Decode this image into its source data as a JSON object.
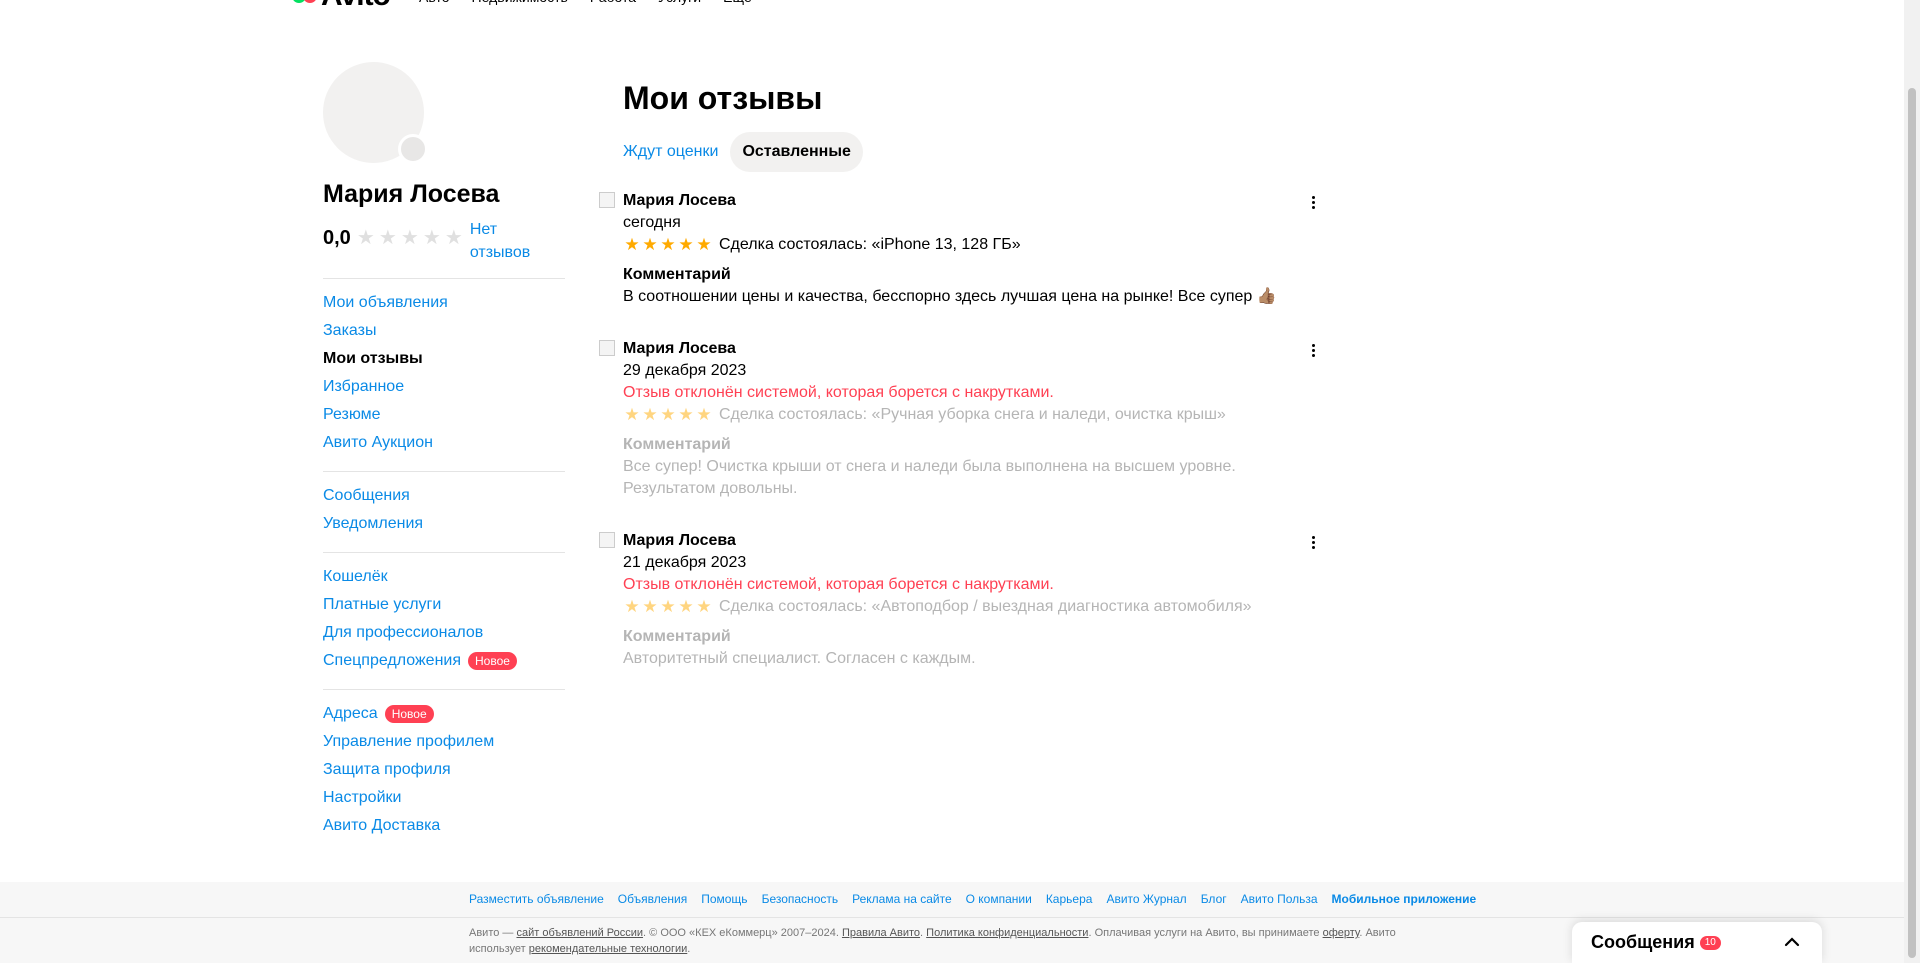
{
  "header": {
    "logo_text": "Avito",
    "nav": [
      "Авто",
      "Недвижимость",
      "Работа",
      "Услуги",
      "Ещё"
    ]
  },
  "profile": {
    "name": "Мария Лосева",
    "rating": "0,0",
    "no_reviews": "Нет отзывов",
    "star_count": 5,
    "filled_stars": 0
  },
  "sidebar": {
    "groups": [
      [
        {
          "label": "Мои объявления"
        },
        {
          "label": "Заказы"
        },
        {
          "label": "Мои отзывы",
          "active": true
        },
        {
          "label": "Избранное"
        },
        {
          "label": "Резюме"
        },
        {
          "label": "Авито Аукцион"
        }
      ],
      [
        {
          "label": "Сообщения"
        },
        {
          "label": "Уведомления"
        }
      ],
      [
        {
          "label": "Кошелёк"
        },
        {
          "label": "Платные услуги"
        },
        {
          "label": "Для профессионалов"
        },
        {
          "label": "Спецпредложения",
          "badge": "Новое"
        }
      ],
      [
        {
          "label": "Адреса",
          "badge": "Новое"
        },
        {
          "label": "Управление профилем"
        },
        {
          "label": "Защита профиля"
        },
        {
          "label": "Настройки"
        },
        {
          "label": "Авито Доставка"
        }
      ]
    ]
  },
  "main": {
    "title": "Мои отзывы",
    "tabs": [
      {
        "label": "Ждут оценки",
        "active": false
      },
      {
        "label": "Оставленные",
        "active": true
      }
    ],
    "reviews": [
      {
        "author": "Мария Лосева",
        "date": "сегодня",
        "rejected": "",
        "rating": 5,
        "deal": "Сделка состоялась: «iPhone 13, 128 ГБ»",
        "comment_title": "Комментарий",
        "comment": "В соотношении цены и качества, бесспорно здесь лучшая цена на рынке! Все супер 👍🏽",
        "muted": false
      },
      {
        "author": "Мария Лосева",
        "date": "29 декабря 2023",
        "rejected": "Отзыв отклонён системой, которая борется с накрутками.",
        "rating": 5,
        "deal": "Сделка состоялась: «Ручная уборка снега и наледи, очистка крыш»",
        "comment_title": "Комментарий",
        "comment": "Все супер! Очистка крыши от снега и наледи была выполнена на высшем уровне. Результатом довольны.",
        "muted": true
      },
      {
        "author": "Мария Лосева",
        "date": "21 декабря 2023",
        "rejected": "Отзыв отклонён системой, которая борется с накрутками.",
        "rating": 5,
        "deal": "Сделка состоялась: «Автоподбор / выездная диагностика автомобиля»",
        "comment_title": "Комментарий",
        "comment": "Авторитетный специалист. Согласен с каждым.",
        "muted": true
      }
    ]
  },
  "footer": {
    "links": [
      {
        "label": "Разместить объявление"
      },
      {
        "label": "Объявления"
      },
      {
        "label": "Помощь"
      },
      {
        "label": "Безопасность"
      },
      {
        "label": "Реклама на сайте"
      },
      {
        "label": "О компании"
      },
      {
        "label": "Карьера"
      },
      {
        "label": "Авито Журнал"
      },
      {
        "label": "Блог"
      },
      {
        "label": "Авито Польза"
      },
      {
        "label": "Мобильное приложение",
        "bold": true
      }
    ],
    "legal_parts": [
      {
        "t": "Авито — "
      },
      {
        "t": "сайт объявлений России",
        "u": true
      },
      {
        "t": ". © ООО «КЕХ еКоммерц» 2007–2024. "
      },
      {
        "t": "Правила Авито",
        "u": true
      },
      {
        "t": ". "
      },
      {
        "t": "Политика конфиденциальности",
        "u": true
      },
      {
        "t": ". Оплачивая услуги на Авито, вы принимаете "
      },
      {
        "t": "оферту",
        "u": true
      },
      {
        "t": ". Авито использует "
      },
      {
        "t": "рекомендательные технологии",
        "u": true
      },
      {
        "t": "."
      }
    ]
  },
  "messenger": {
    "title": "Сообщения",
    "count": "10"
  },
  "colors": {
    "link": "#0a8ae6",
    "accent_red": "#ff4053",
    "star": "#ffaa00",
    "logo_green": "#04e061"
  }
}
